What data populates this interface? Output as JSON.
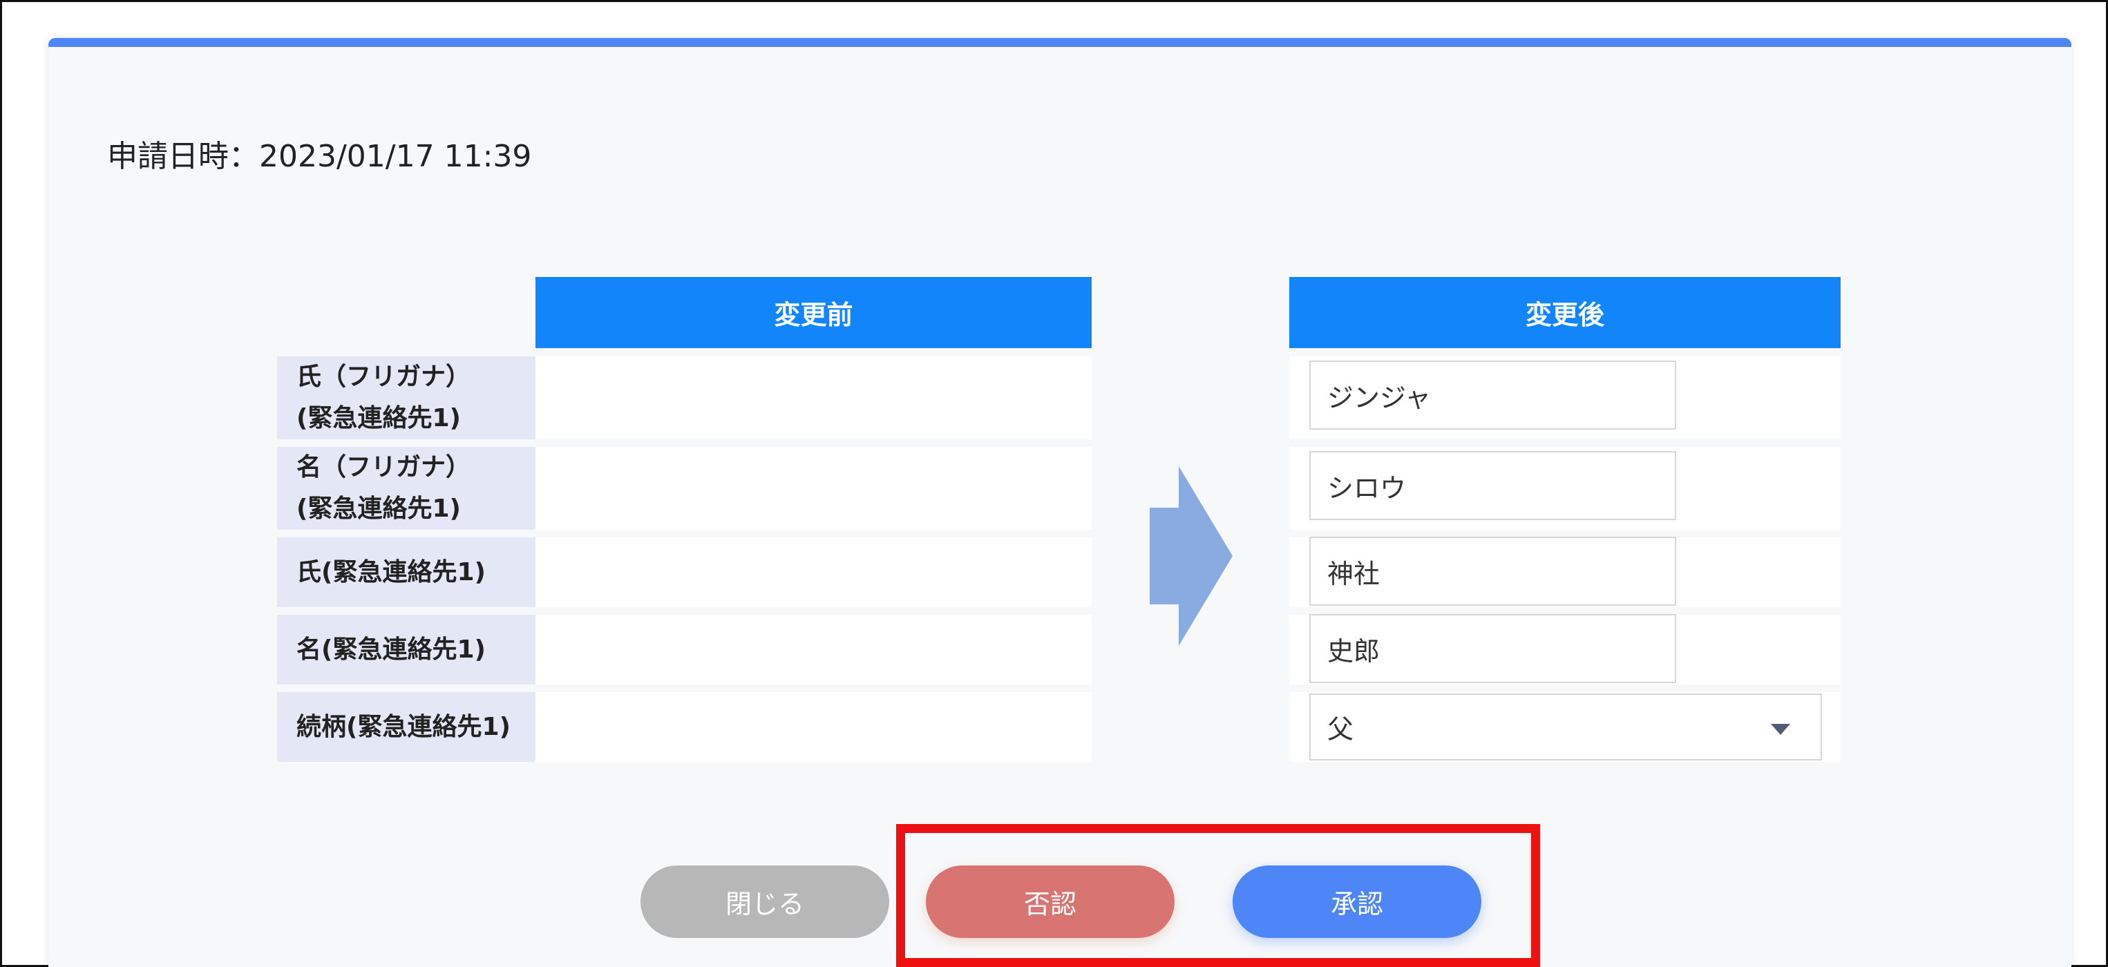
{
  "application": {
    "applied_at_label": "申請日時：2023/01/17 11:39"
  },
  "table": {
    "before_header": "変更前",
    "after_header": "変更後",
    "rows": [
      {
        "label_line1": "氏（フリガナ）",
        "label_line2": "(緊急連絡先1)",
        "before": "",
        "after": "ジンジャ"
      },
      {
        "label_line1": "名（フリガナ）",
        "label_line2": "(緊急連絡先1)",
        "before": "",
        "after": "シロウ"
      },
      {
        "label_line1": "氏(緊急連絡先1)",
        "label_line2": "",
        "before": "",
        "after": "神社"
      },
      {
        "label_line1": "名(緊急連絡先1)",
        "label_line2": "",
        "before": "",
        "after": "史郎"
      },
      {
        "label_line1": "続柄(緊急連絡先1)",
        "label_line2": "",
        "before": "",
        "after": "父"
      }
    ]
  },
  "icons": {
    "arrow": "arrow-right-icon",
    "caret": "chevron-down-icon"
  },
  "buttons": {
    "close_label": "閉じる",
    "reject_label": "否認",
    "approve_label": "承認"
  },
  "colors": {
    "accent": "#4f86f7",
    "header_blue": "#1285fb",
    "reject": "#d87573",
    "close": "#b7b7b7",
    "highlight": "#ee1111"
  }
}
